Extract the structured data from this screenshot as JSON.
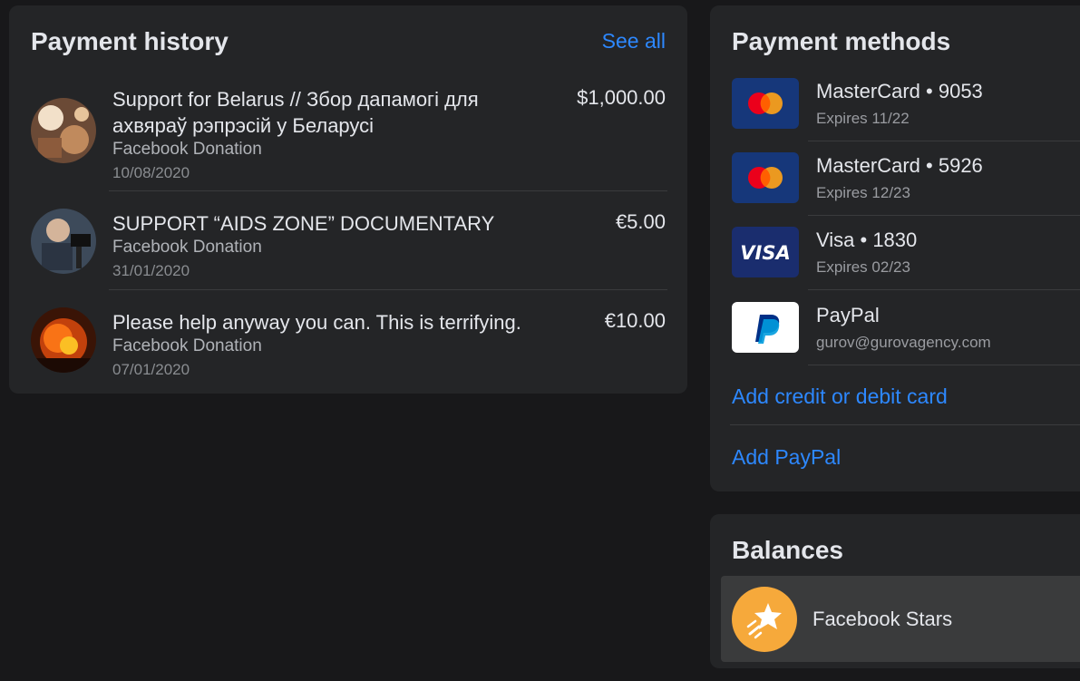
{
  "history": {
    "title": "Payment history",
    "see_all": "See all",
    "items": [
      {
        "title": "Support for Belarus // Збор дапамогі для ахвяраў рэпрэсій у Беларусі",
        "amount": "$1,000.00",
        "source": "Facebook Donation",
        "date": "10/08/2020"
      },
      {
        "title": "SUPPORT “AIDS ZONE” DOCUMENTARY",
        "amount": "€5.00",
        "source": "Facebook Donation",
        "date": "31/01/2020"
      },
      {
        "title": "Please help anyway you can. This is terrifying.",
        "amount": "€10.00",
        "source": "Facebook Donation",
        "date": "07/01/2020"
      }
    ]
  },
  "methods": {
    "title": "Payment methods",
    "items": [
      {
        "name": "MasterCard • 9053",
        "detail": "Expires 11/22",
        "icon": "mastercard-icon"
      },
      {
        "name": "MasterCard • 5926",
        "detail": "Expires 12/23",
        "icon": "mastercard-icon"
      },
      {
        "name": "Visa • 1830",
        "detail": "Expires 02/23",
        "icon": "visa-icon",
        "logo_text": "VISA"
      },
      {
        "name": "PayPal",
        "detail": "gurov@gurovagency.com",
        "icon": "paypal-icon"
      }
    ],
    "add_card": "Add credit or debit card",
    "add_paypal": "Add PayPal"
  },
  "balances": {
    "title": "Balances",
    "stars_label": "Facebook Stars",
    "stars_icon": "star-icon"
  },
  "colors": {
    "background": "#18181a",
    "card": "#242527",
    "link": "#2d88ff",
    "text_primary": "#e4e6eb",
    "text_secondary": "#b0b3b8",
    "mastercard_bg": "#16377a",
    "visa_bg": "#1a2d6e",
    "stars": "#f6a93b"
  }
}
